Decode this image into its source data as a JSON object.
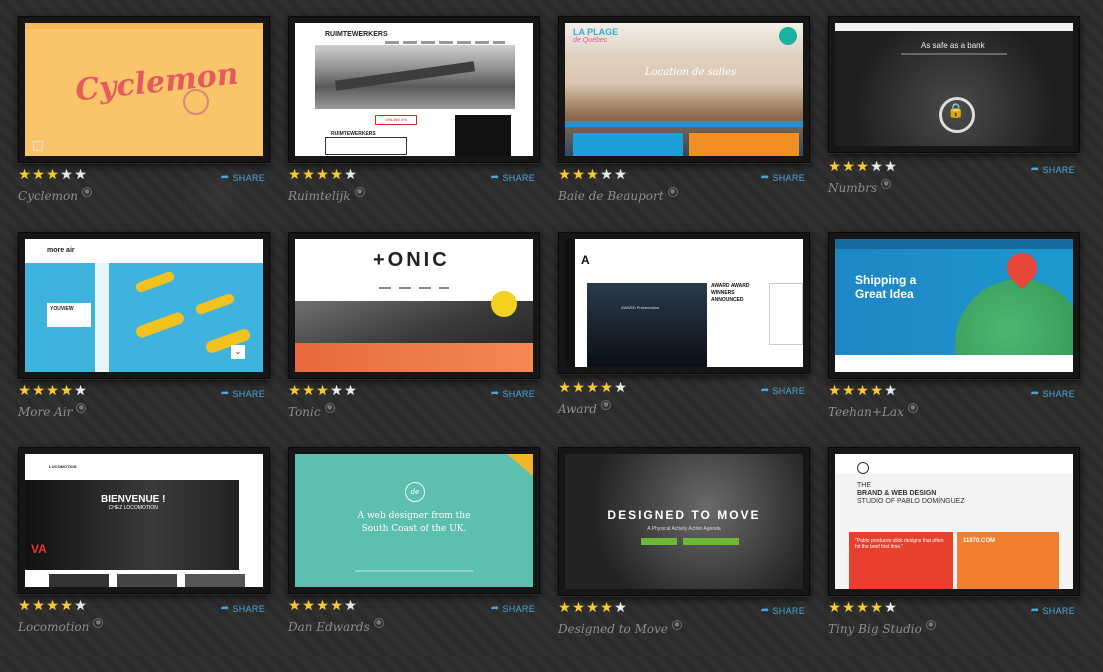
{
  "share_label": "SHARE",
  "colors": {
    "background": "#2c2c2c",
    "share_blue": "#4aa6d6",
    "star_on": "#f5cc36",
    "star_off": "#e9e9e9",
    "title_gray": "#8d8d8d"
  },
  "cards": [
    {
      "title": "Cyclemon",
      "stars": 3
    },
    {
      "title": "Ruimtelijk",
      "stars": 4
    },
    {
      "title": "Baie de Beauport",
      "stars": 3
    },
    {
      "title": "Numbrs",
      "stars": 3
    },
    {
      "title": "More Air",
      "stars": 4
    },
    {
      "title": "Tonic",
      "stars": 3
    },
    {
      "title": "Award",
      "stars": 4
    },
    {
      "title": "Teehan+Lax",
      "stars": 4
    },
    {
      "title": "Locomotion",
      "stars": 4
    },
    {
      "title": "Dan Edwards",
      "stars": 4
    },
    {
      "title": "Designed to Move",
      "stars": 4
    },
    {
      "title": "Tiny Big Studio",
      "stars": 4
    }
  ],
  "thumbs": {
    "cyclemon": {
      "logo": "Cyclemon"
    },
    "ruimtelijk": {
      "brand": "RUIMTEWERKERS",
      "button": "ONLINE EN",
      "brand2": "RUIMTEWERKERS"
    },
    "baie": {
      "logo_line1": "LA PLAGE",
      "logo_line2": "de Québec",
      "headline": "Location de salles"
    },
    "numbrs": {
      "headline": "As safe as a bank"
    },
    "moreair": {
      "logo": "more air",
      "card_title": "YOUVIEW"
    },
    "tonic": {
      "logo": "+ONIC"
    },
    "award": {
      "logo": "A",
      "headline_1": "AWARD AWARD",
      "headline_2": "WINNERS",
      "headline_3": "ANNOUNCED",
      "screen_text": "AWARD Presentation"
    },
    "teehan": {
      "headline_1": "Shipping a",
      "headline_2": "Great Idea"
    },
    "locomotion": {
      "headline_1": "BIENVENUE !",
      "headline_2": "CHEZ LOCOMOTION",
      "logo": "LOCOMOTION"
    },
    "dan": {
      "monogram": "de",
      "line1": "A web designer from the",
      "line2": "South Coast of the UK."
    },
    "move": {
      "headline": "DESIGNED TO MOVE",
      "sub": "A Physical Activity Action Agenda"
    },
    "tiny": {
      "line1": "THE",
      "line2": "BRAND & WEB DESIGN",
      "line3": "STUDIO OF PABLO DOMÍNGUEZ",
      "quote": "\"Pablo produces slick designs that often hit the brief first time.\"",
      "domain": "11870.COM"
    }
  }
}
